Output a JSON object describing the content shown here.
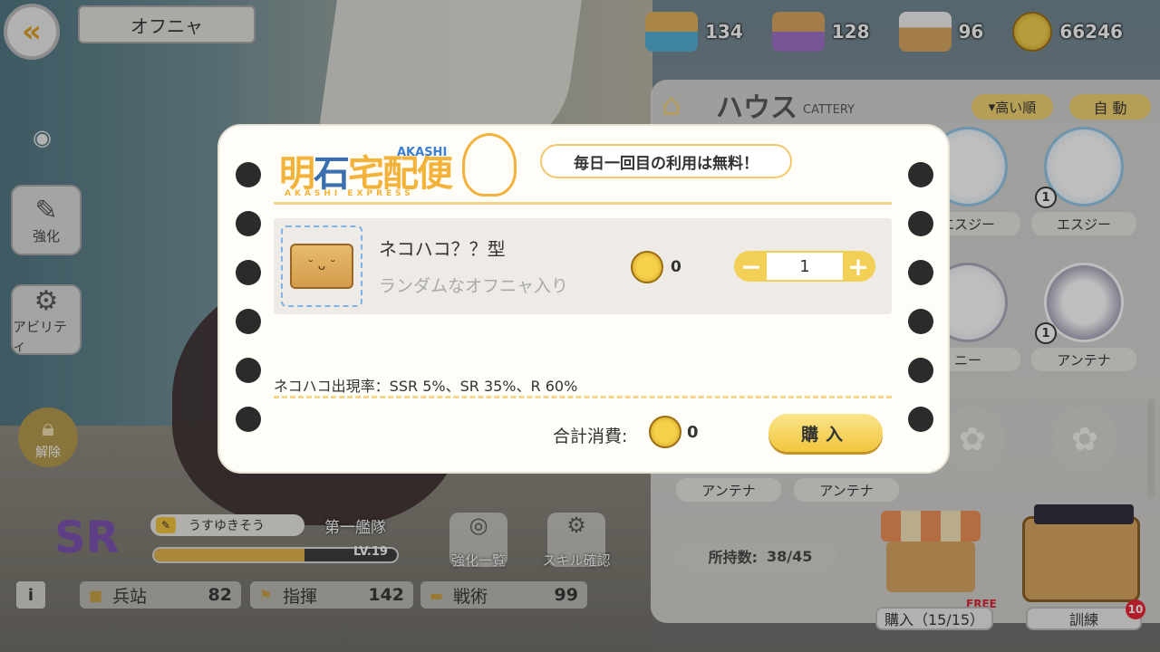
{
  "header": {
    "back_icon": "back-arrow-icon",
    "title": "オフニャ"
  },
  "resources": [
    {
      "icon": "box-blue-icon",
      "value": "134"
    },
    {
      "icon": "box-purple-icon",
      "value": "128"
    },
    {
      "icon": "box-captain-icon",
      "value": "96"
    },
    {
      "icon": "coin-icon",
      "value": "66246"
    }
  ],
  "house": {
    "title": "ハウス",
    "subtitle": "CATTERY",
    "sort_label": "高い順",
    "auto_label": "自 動",
    "cats": [
      {
        "name": "エスジー",
        "level": ""
      },
      {
        "name": "エスジー",
        "level": "1"
      },
      {
        "name": "ニー",
        "level": ""
      },
      {
        "name": "アンテナ",
        "level": "1"
      },
      {
        "name": "アンテナ",
        "level": ""
      },
      {
        "name": "アンテナ",
        "level": ""
      }
    ],
    "owned_label": "所持数:",
    "owned_value": "38/45",
    "buy_label": "購入（15/15）",
    "free_tag": "FREE",
    "train_label": "訓練",
    "train_badge": "10"
  },
  "side": {
    "enhance": "強化",
    "ability": "アビリティ",
    "unlock": "解除"
  },
  "ship": {
    "rarity": "SR",
    "name": "うすゆきそう",
    "fleet": "第一艦隊",
    "level": "LV.19",
    "exp_fraction": 0.62,
    "enhance_list": "強化一覧",
    "skill_check": "スキル確認",
    "info_label": "i",
    "stats": [
      {
        "icon": "box-icon",
        "label": "兵站",
        "value": "82"
      },
      {
        "icon": "flag-icon",
        "label": "指揮",
        "value": "142"
      },
      {
        "icon": "book-icon",
        "label": "戦術",
        "value": "99"
      }
    ]
  },
  "modal": {
    "logo_main_1": "明",
    "logo_main_2": "石",
    "logo_main_3": "宅配便",
    "logo_akashi": "AKASHI",
    "logo_express": "AKASHI EXPRESS",
    "speech": "毎日一回目の利用は無料！",
    "item_name": "ネコハコ？？型",
    "item_desc": "ランダムなオフニャ入り",
    "price": "0",
    "quantity": "1",
    "minus": "−",
    "plus": "+",
    "rates": "ネコハコ出現率：SSR 5%、SR 35%、R 60%",
    "total_label": "合計消費:",
    "total_value": "0",
    "buy_label": "購入"
  },
  "colors": {
    "accent_gold": "#f2cf55",
    "rarity_sr": "#7a4fb0",
    "modal_bg": "#fffdf7"
  }
}
